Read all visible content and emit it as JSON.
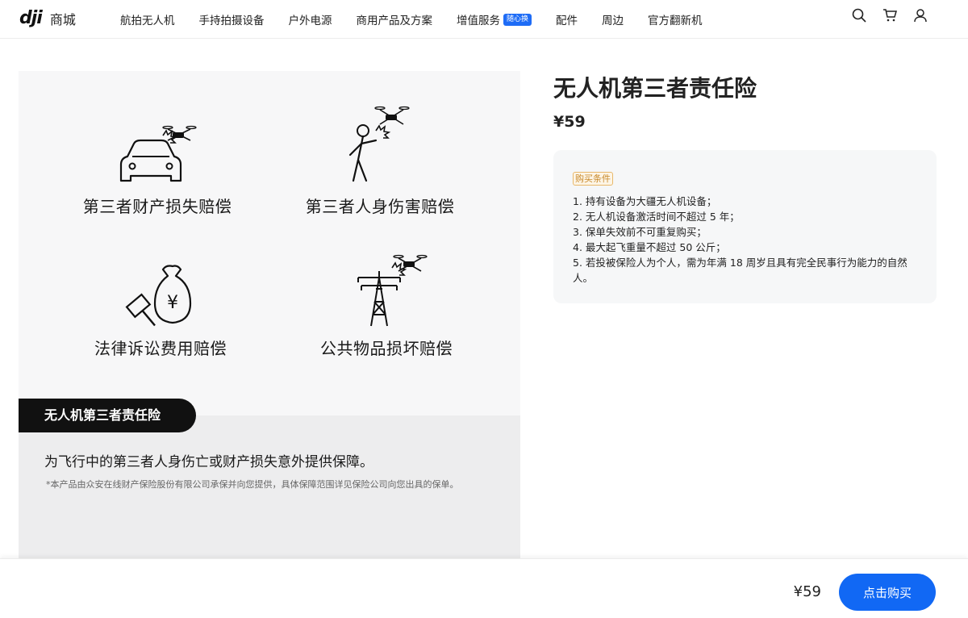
{
  "header": {
    "logo_mark": "dji",
    "logo_text": "商城",
    "nav": [
      {
        "label": "航拍无人机"
      },
      {
        "label": "手持拍摄设备"
      },
      {
        "label": "户外电源"
      },
      {
        "label": "商用产品及方案"
      },
      {
        "label": "增值服务",
        "badge": "随心换"
      },
      {
        "label": "配件"
      },
      {
        "label": "周边"
      },
      {
        "label": "官方翻新机"
      }
    ],
    "icons": [
      "search-icon",
      "cart-icon",
      "user-icon"
    ]
  },
  "hero": {
    "features": [
      {
        "label": "第三者财产损失赔偿",
        "icon": "car-drone-icon"
      },
      {
        "label": "第三者人身伤害赔偿",
        "icon": "person-drone-icon"
      },
      {
        "label": "法律诉讼费用赔偿",
        "icon": "money-gavel-icon"
      },
      {
        "label": "公共物品损坏赔偿",
        "icon": "power-tower-icon"
      }
    ],
    "tag": "无人机第三者责任险",
    "description": "为飞行中的第三者人身伤亡或财产损失意外提供保障。",
    "note": "*本产品由众安在线财产保险股份有限公司承保并向您提供，具体保障范围详见保险公司向您出具的保单。"
  },
  "product": {
    "title": "无人机第三者责任险",
    "price": "¥59",
    "conditions_tag": "购买条件",
    "conditions": [
      "1. 持有设备为大疆无人机设备；",
      "2. 无人机设备激活时间不超过 5 年；",
      "3. 保单失效前不可重复购买；",
      "4. 最大起飞重量不超过 50 公斤；",
      "5. 若投被保险人为个人，需为年满 18 周岁且具有完全民事行为能力的自然人。"
    ]
  },
  "footer": {
    "price": "¥59",
    "buy_label": "点击购买"
  },
  "colors": {
    "accent": "#1168f4",
    "badge": "#1e6cf6",
    "condition_tag": "#c98a2c"
  }
}
